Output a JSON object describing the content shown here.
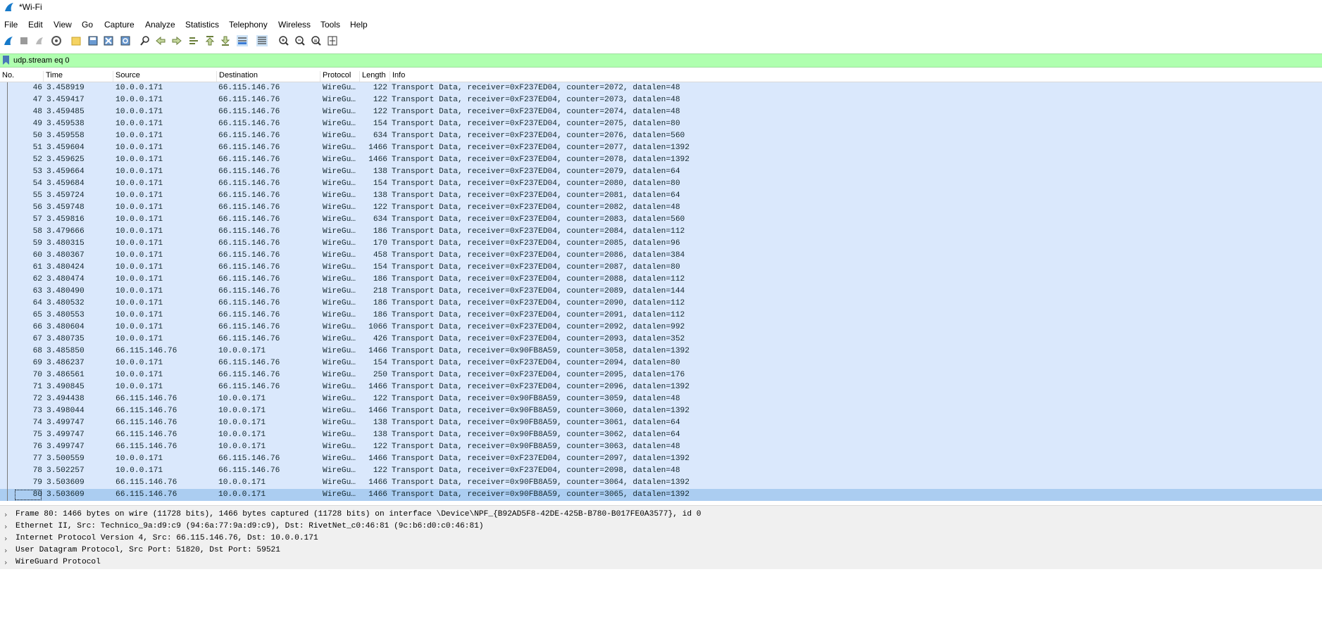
{
  "window": {
    "title": "*Wi-Fi",
    "app_icon": "wireshark-fin-icon"
  },
  "menu": [
    "File",
    "Edit",
    "View",
    "Go",
    "Capture",
    "Analyze",
    "Statistics",
    "Telephony",
    "Wireless",
    "Tools",
    "Help"
  ],
  "toolbar": {
    "icons": [
      "start-capture-icon",
      "stop-capture-icon",
      "restart-capture-icon",
      "capture-options-icon",
      "open-file-icon",
      "save-file-icon",
      "close-file-icon",
      "reload-file-icon",
      "find-packet-icon",
      "go-back-icon",
      "go-forward-icon",
      "go-to-packet-icon",
      "go-first-icon",
      "go-last-icon",
      "auto-scroll-icon",
      "colorize-icon",
      "zoom-in-icon",
      "zoom-out-icon",
      "zoom-normal-icon",
      "resize-columns-icon"
    ]
  },
  "filter": {
    "value": "udp.stream eq 0",
    "color": "#afffaf"
  },
  "columns": [
    "No.",
    "Time",
    "Source",
    "Destination",
    "Protocol",
    "Length",
    "Info"
  ],
  "packets": [
    {
      "no": "46",
      "time": "3.458919",
      "src": "10.0.0.171",
      "dst": "66.115.146.76",
      "proto": "WireGu…",
      "len": "122",
      "info": "Transport Data, receiver=0xF237ED04, counter=2072, datalen=48"
    },
    {
      "no": "47",
      "time": "3.459417",
      "src": "10.0.0.171",
      "dst": "66.115.146.76",
      "proto": "WireGu…",
      "len": "122",
      "info": "Transport Data, receiver=0xF237ED04, counter=2073, datalen=48"
    },
    {
      "no": "48",
      "time": "3.459485",
      "src": "10.0.0.171",
      "dst": "66.115.146.76",
      "proto": "WireGu…",
      "len": "122",
      "info": "Transport Data, receiver=0xF237ED04, counter=2074, datalen=48"
    },
    {
      "no": "49",
      "time": "3.459538",
      "src": "10.0.0.171",
      "dst": "66.115.146.76",
      "proto": "WireGu…",
      "len": "154",
      "info": "Transport Data, receiver=0xF237ED04, counter=2075, datalen=80"
    },
    {
      "no": "50",
      "time": "3.459558",
      "src": "10.0.0.171",
      "dst": "66.115.146.76",
      "proto": "WireGu…",
      "len": "634",
      "info": "Transport Data, receiver=0xF237ED04, counter=2076, datalen=560"
    },
    {
      "no": "51",
      "time": "3.459604",
      "src": "10.0.0.171",
      "dst": "66.115.146.76",
      "proto": "WireGu…",
      "len": "1466",
      "info": "Transport Data, receiver=0xF237ED04, counter=2077, datalen=1392"
    },
    {
      "no": "52",
      "time": "3.459625",
      "src": "10.0.0.171",
      "dst": "66.115.146.76",
      "proto": "WireGu…",
      "len": "1466",
      "info": "Transport Data, receiver=0xF237ED04, counter=2078, datalen=1392"
    },
    {
      "no": "53",
      "time": "3.459664",
      "src": "10.0.0.171",
      "dst": "66.115.146.76",
      "proto": "WireGu…",
      "len": "138",
      "info": "Transport Data, receiver=0xF237ED04, counter=2079, datalen=64"
    },
    {
      "no": "54",
      "time": "3.459684",
      "src": "10.0.0.171",
      "dst": "66.115.146.76",
      "proto": "WireGu…",
      "len": "154",
      "info": "Transport Data, receiver=0xF237ED04, counter=2080, datalen=80"
    },
    {
      "no": "55",
      "time": "3.459724",
      "src": "10.0.0.171",
      "dst": "66.115.146.76",
      "proto": "WireGu…",
      "len": "138",
      "info": "Transport Data, receiver=0xF237ED04, counter=2081, datalen=64"
    },
    {
      "no": "56",
      "time": "3.459748",
      "src": "10.0.0.171",
      "dst": "66.115.146.76",
      "proto": "WireGu…",
      "len": "122",
      "info": "Transport Data, receiver=0xF237ED04, counter=2082, datalen=48"
    },
    {
      "no": "57",
      "time": "3.459816",
      "src": "10.0.0.171",
      "dst": "66.115.146.76",
      "proto": "WireGu…",
      "len": "634",
      "info": "Transport Data, receiver=0xF237ED04, counter=2083, datalen=560"
    },
    {
      "no": "58",
      "time": "3.479666",
      "src": "10.0.0.171",
      "dst": "66.115.146.76",
      "proto": "WireGu…",
      "len": "186",
      "info": "Transport Data, receiver=0xF237ED04, counter=2084, datalen=112"
    },
    {
      "no": "59",
      "time": "3.480315",
      "src": "10.0.0.171",
      "dst": "66.115.146.76",
      "proto": "WireGu…",
      "len": "170",
      "info": "Transport Data, receiver=0xF237ED04, counter=2085, datalen=96"
    },
    {
      "no": "60",
      "time": "3.480367",
      "src": "10.0.0.171",
      "dst": "66.115.146.76",
      "proto": "WireGu…",
      "len": "458",
      "info": "Transport Data, receiver=0xF237ED04, counter=2086, datalen=384"
    },
    {
      "no": "61",
      "time": "3.480424",
      "src": "10.0.0.171",
      "dst": "66.115.146.76",
      "proto": "WireGu…",
      "len": "154",
      "info": "Transport Data, receiver=0xF237ED04, counter=2087, datalen=80"
    },
    {
      "no": "62",
      "time": "3.480474",
      "src": "10.0.0.171",
      "dst": "66.115.146.76",
      "proto": "WireGu…",
      "len": "186",
      "info": "Transport Data, receiver=0xF237ED04, counter=2088, datalen=112"
    },
    {
      "no": "63",
      "time": "3.480490",
      "src": "10.0.0.171",
      "dst": "66.115.146.76",
      "proto": "WireGu…",
      "len": "218",
      "info": "Transport Data, receiver=0xF237ED04, counter=2089, datalen=144"
    },
    {
      "no": "64",
      "time": "3.480532",
      "src": "10.0.0.171",
      "dst": "66.115.146.76",
      "proto": "WireGu…",
      "len": "186",
      "info": "Transport Data, receiver=0xF237ED04, counter=2090, datalen=112"
    },
    {
      "no": "65",
      "time": "3.480553",
      "src": "10.0.0.171",
      "dst": "66.115.146.76",
      "proto": "WireGu…",
      "len": "186",
      "info": "Transport Data, receiver=0xF237ED04, counter=2091, datalen=112"
    },
    {
      "no": "66",
      "time": "3.480604",
      "src": "10.0.0.171",
      "dst": "66.115.146.76",
      "proto": "WireGu…",
      "len": "1066",
      "info": "Transport Data, receiver=0xF237ED04, counter=2092, datalen=992"
    },
    {
      "no": "67",
      "time": "3.480735",
      "src": "10.0.0.171",
      "dst": "66.115.146.76",
      "proto": "WireGu…",
      "len": "426",
      "info": "Transport Data, receiver=0xF237ED04, counter=2093, datalen=352"
    },
    {
      "no": "68",
      "time": "3.485850",
      "src": "66.115.146.76",
      "dst": "10.0.0.171",
      "proto": "WireGu…",
      "len": "1466",
      "info": "Transport Data, receiver=0x90FB8A59, counter=3058, datalen=1392"
    },
    {
      "no": "69",
      "time": "3.486237",
      "src": "10.0.0.171",
      "dst": "66.115.146.76",
      "proto": "WireGu…",
      "len": "154",
      "info": "Transport Data, receiver=0xF237ED04, counter=2094, datalen=80"
    },
    {
      "no": "70",
      "time": "3.486561",
      "src": "10.0.0.171",
      "dst": "66.115.146.76",
      "proto": "WireGu…",
      "len": "250",
      "info": "Transport Data, receiver=0xF237ED04, counter=2095, datalen=176"
    },
    {
      "no": "71",
      "time": "3.490845",
      "src": "10.0.0.171",
      "dst": "66.115.146.76",
      "proto": "WireGu…",
      "len": "1466",
      "info": "Transport Data, receiver=0xF237ED04, counter=2096, datalen=1392"
    },
    {
      "no": "72",
      "time": "3.494438",
      "src": "66.115.146.76",
      "dst": "10.0.0.171",
      "proto": "WireGu…",
      "len": "122",
      "info": "Transport Data, receiver=0x90FB8A59, counter=3059, datalen=48"
    },
    {
      "no": "73",
      "time": "3.498044",
      "src": "66.115.146.76",
      "dst": "10.0.0.171",
      "proto": "WireGu…",
      "len": "1466",
      "info": "Transport Data, receiver=0x90FB8A59, counter=3060, datalen=1392"
    },
    {
      "no": "74",
      "time": "3.499747",
      "src": "66.115.146.76",
      "dst": "10.0.0.171",
      "proto": "WireGu…",
      "len": "138",
      "info": "Transport Data, receiver=0x90FB8A59, counter=3061, datalen=64"
    },
    {
      "no": "75",
      "time": "3.499747",
      "src": "66.115.146.76",
      "dst": "10.0.0.171",
      "proto": "WireGu…",
      "len": "138",
      "info": "Transport Data, receiver=0x90FB8A59, counter=3062, datalen=64"
    },
    {
      "no": "76",
      "time": "3.499747",
      "src": "66.115.146.76",
      "dst": "10.0.0.171",
      "proto": "WireGu…",
      "len": "122",
      "info": "Transport Data, receiver=0x90FB8A59, counter=3063, datalen=48"
    },
    {
      "no": "77",
      "time": "3.500559",
      "src": "10.0.0.171",
      "dst": "66.115.146.76",
      "proto": "WireGu…",
      "len": "1466",
      "info": "Transport Data, receiver=0xF237ED04, counter=2097, datalen=1392"
    },
    {
      "no": "78",
      "time": "3.502257",
      "src": "10.0.0.171",
      "dst": "66.115.146.76",
      "proto": "WireGu…",
      "len": "122",
      "info": "Transport Data, receiver=0xF237ED04, counter=2098, datalen=48"
    },
    {
      "no": "79",
      "time": "3.503609",
      "src": "66.115.146.76",
      "dst": "10.0.0.171",
      "proto": "WireGu…",
      "len": "1466",
      "info": "Transport Data, receiver=0x90FB8A59, counter=3064, datalen=1392"
    },
    {
      "no": "80",
      "time": "3.503609",
      "src": "66.115.146.76",
      "dst": "10.0.0.171",
      "proto": "WireGu…",
      "len": "1466",
      "info": "Transport Data, receiver=0x90FB8A59, counter=3065, datalen=1392",
      "selected": true
    }
  ],
  "row_colors": {
    "normal": "#dae8fc",
    "selected": "#abcdf1"
  },
  "details": [
    "Frame 80: 1466 bytes on wire (11728 bits), 1466 bytes captured (11728 bits) on interface \\Device\\NPF_{B92AD5F8-42DE-425B-B780-B017FE0A3577}, id 0",
    "Ethernet II, Src: Technico_9a:d9:c9 (94:6a:77:9a:d9:c9), Dst: RivetNet_c0:46:81 (9c:b6:d0:c0:46:81)",
    "Internet Protocol Version 4, Src: 66.115.146.76, Dst: 10.0.0.171",
    "User Datagram Protocol, Src Port: 51820, Dst Port: 59521",
    "WireGuard Protocol"
  ]
}
